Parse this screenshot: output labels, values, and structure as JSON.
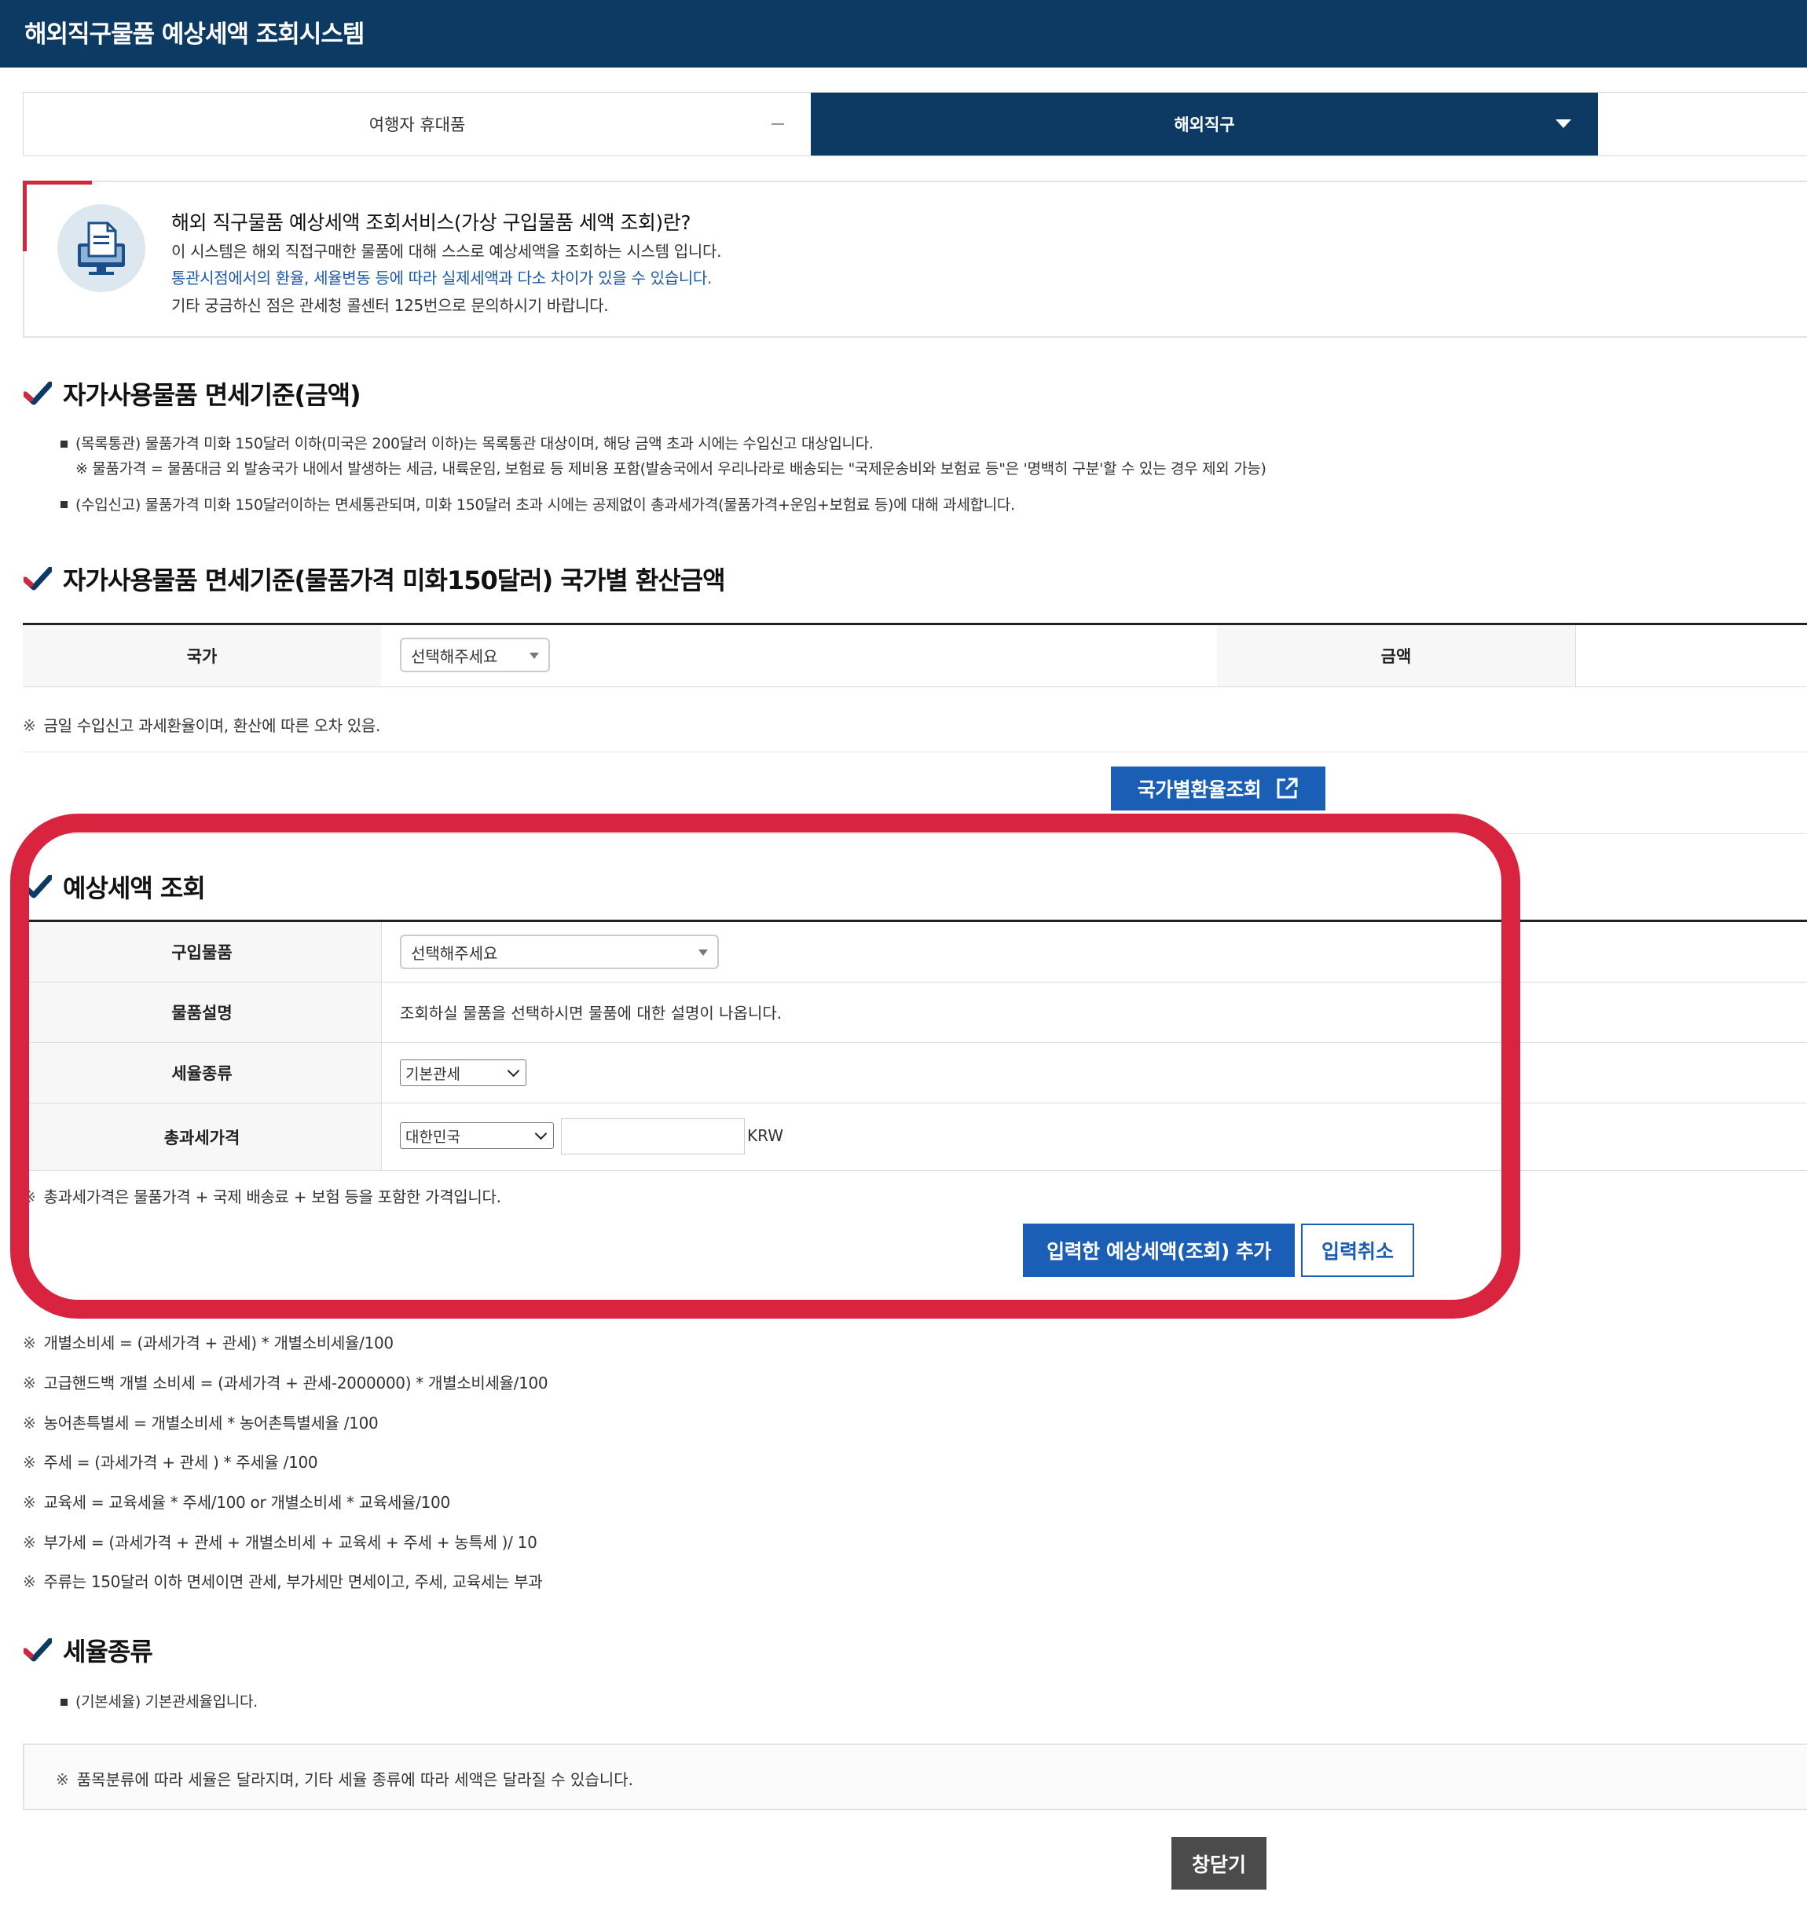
{
  "header": {
    "title": "해외직구물품 예상세액 조회시스템"
  },
  "tabs": [
    {
      "label": "여행자 휴대품"
    },
    {
      "label": "해외직구"
    }
  ],
  "info": {
    "title": "해외 직구물품 예상세액 조회서비스(가상 구입물품 세액 조회)란?",
    "line1": "이 시스템은 해외 직접구매한 물품에 대해 스스로 예상세액을 조회하는 시스템 입니다.",
    "line2": "통관시점에서의 환율, 세율변동 등에 따라 실제세액과 다소 차이가 있을 수 있습니다.",
    "line3": "기타 궁금하신 점은 관세청 콜센터 125번으로 문의하시기 바랍니다."
  },
  "section1": {
    "title": "자가사용물품 면세기준(금액)",
    "bullet1": "(목록통관) 물품가격 미화 150달러 이하(미국은 200달러 이하)는 목록통관 대상이며, 해당 금액 초과 시에는 수입신고 대상입니다.",
    "bullet1_sub": "※ 물품가격 = 물품대금 외 발송국가 내에서 발생하는 세금, 내륙운임, 보험료 등 제비용 포함(발송국에서 우리나라로 배송되는 \"국제운송비와 보험료 등\"은 '명백히 구분'할 수 있는 경우 제외 가능)",
    "bullet2": "(수입신고) 물품가격 미화 150달러이하는 면세통관되며, 미화 150달러 초과 시에는 공제없이 총과세가격(물품가격+운임+보험료 등)에 대해 과세합니다."
  },
  "section2": {
    "title": "자가사용물품 면세기준(물품가격 미화150달러) 국가별 환산금액",
    "country_header": "국가",
    "country_select": "선택해주세요",
    "amount_header": "금액",
    "note_mark": "※",
    "note": "금일 수입신고 과세환율이며, 환산에 따른 오차 있음.",
    "rate_button": "국가별환율조회"
  },
  "section3": {
    "title": "예상세액 조회",
    "rows": [
      {
        "label": "구입물품",
        "select": "선택해주세요"
      },
      {
        "label": "물품설명",
        "text": "조회하실 물품을 선택하시면 물품에 대한 설명이 나옵니다."
      },
      {
        "label": "세율종류",
        "select": "기본관세"
      },
      {
        "label": "총과세가격",
        "select": "대한민국",
        "input_value": "",
        "unit": "KRW"
      }
    ],
    "note_mark": "※",
    "note": "총과세가격은 물품가격 + 국제 배송료 + 보험 등을 포함한 가격입니다.",
    "add_button": "입력한 예상세액(조회) 추가",
    "cancel_button": "입력취소"
  },
  "formulas": {
    "mark": "※",
    "items": [
      "개별소비세 = (과세가격 + 관세) * 개별소비세율/100",
      "고급핸드백 개별 소비세 = (과세가격 + 관세-2000000) * 개별소비세율/100",
      "농어촌특별세 = 개별소비세 * 농어촌특별세율 /100",
      "주세 = (과세가격 + 관세 ) * 주세율 /100",
      "교육세 = 교육세율 * 주세/100 or 개별소비세 * 교육세율/100",
      "부가세 = (과세가격 + 관세 + 개별소비세 + 교육세 + 주세 + 농특세 )/ 10",
      "주류는 150달러 이하 면세이면 관세, 부가세만 면세이고, 주세, 교육세는 부과"
    ]
  },
  "section4": {
    "title": "세율종류",
    "bullet": "(기본세율) 기본관세율입니다.",
    "note_mark": "※",
    "note": "품목분류에 따라 세율은 달라지며, 기타 세율 종류에 따라 세액은 달라질 수 있습니다."
  },
  "close_button": "창닫기",
  "colors": {
    "header_bg": "#0d3a63",
    "accent_red": "#d8243f",
    "button_blue": "#1a5eb5"
  }
}
